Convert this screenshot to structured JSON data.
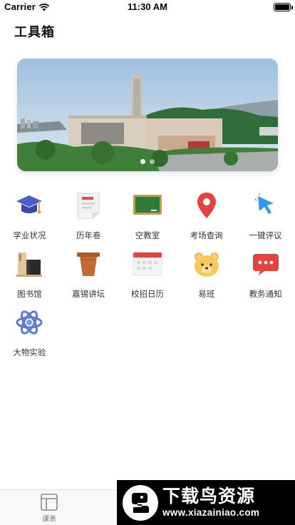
{
  "status": {
    "carrier": "Carrier",
    "time": "11:30 AM"
  },
  "header": {
    "title": "工具箱"
  },
  "banner": {
    "slides": 2,
    "active_slide": 1
  },
  "tools": [
    {
      "label": "学业状况",
      "icon": "graduation-cap-icon"
    },
    {
      "label": "历年卷",
      "icon": "exam-paper-icon"
    },
    {
      "label": "空教室",
      "icon": "chalkboard-icon"
    },
    {
      "label": "考场查询",
      "icon": "location-pin-icon"
    },
    {
      "label": "一键评议",
      "icon": "cursor-click-icon"
    },
    {
      "label": "图书馆",
      "icon": "library-books-icon"
    },
    {
      "label": "嘉锡讲坛",
      "icon": "podium-icon"
    },
    {
      "label": "校招日历",
      "icon": "calendar-icon"
    },
    {
      "label": "易班",
      "icon": "bear-icon"
    },
    {
      "label": "教务通知",
      "icon": "message-icon"
    },
    {
      "label": "大物实验",
      "icon": "atom-icon"
    }
  ],
  "tabbar": {
    "tabs": [
      {
        "label": "课表",
        "icon": "schedule-icon"
      }
    ]
  },
  "watermark": {
    "title": "下载鸟资源",
    "url": "www.xiazainiao.com"
  }
}
